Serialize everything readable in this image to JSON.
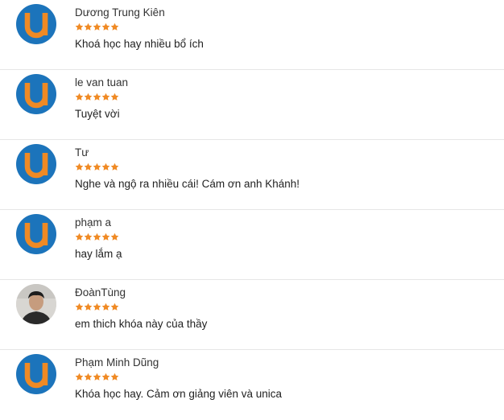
{
  "brand": {
    "logo_letter": "U",
    "logo_bg": "#1c74bb",
    "logo_fg": "#f08a24",
    "star_color": "#f08a24"
  },
  "reviews": [
    {
      "name": "Dương Trung Kiên",
      "rating": 5,
      "comment": "Khoá học hay nhiều bổ ích",
      "avatar": "unica-logo"
    },
    {
      "name": "le van tuan",
      "rating": 5,
      "comment": "Tuyệt vời",
      "avatar": "unica-logo"
    },
    {
      "name": "Tư",
      "rating": 5,
      "comment": "Nghe và ngộ ra nhiều cái! Cám ơn anh Khánh!",
      "avatar": "unica-logo"
    },
    {
      "name": "phạm a",
      "rating": 5,
      "comment": "hay lắm ạ",
      "avatar": "unica-logo"
    },
    {
      "name": "ĐoànTùng",
      "rating": 5,
      "comment": "em thich khóa này của thầy",
      "avatar": "user-photo"
    },
    {
      "name": "Phạm Minh Dũng",
      "rating": 5,
      "comment": "Khóa học hay. Cảm ơn giảng viên và unica",
      "avatar": "unica-logo"
    }
  ]
}
